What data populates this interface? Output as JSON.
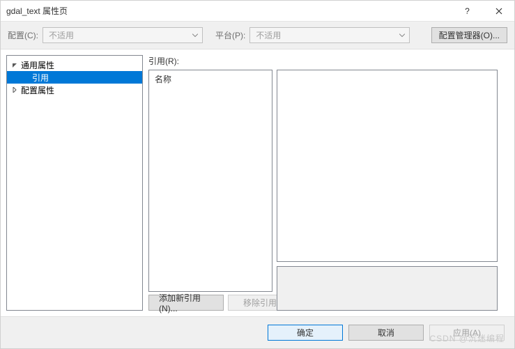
{
  "title": "gdal_text 属性页",
  "toolbar": {
    "config_label": "配置(C):",
    "config_value": "不适用",
    "platform_label": "平台(P):",
    "platform_value": "不适用",
    "config_manager": "配置管理器(O)..."
  },
  "tree": {
    "common_properties": "通用属性",
    "reference": "引用",
    "config_properties": "配置属性"
  },
  "right": {
    "label": "引用(R):",
    "name_header": "名称",
    "add_reference": "添加新引用(N)...",
    "remove_reference": "移除引用(E)"
  },
  "footer": {
    "ok": "确定",
    "cancel": "取消",
    "apply": "应用(A)"
  },
  "watermark": "CSDN @沉迷编程"
}
